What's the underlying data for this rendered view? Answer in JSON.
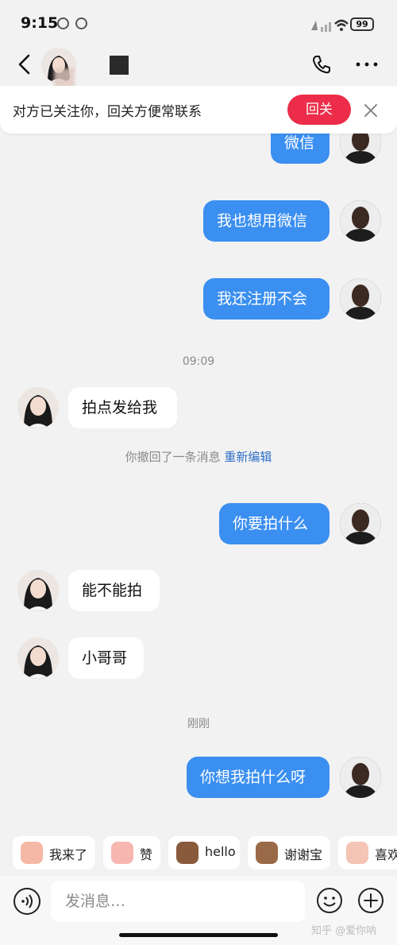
{
  "status": {
    "time": "9:15",
    "battery": "99"
  },
  "nav": {
    "name_redacted": ""
  },
  "banner": {
    "text": "对方已关注你，回关方便常联系",
    "follow_label": "回关"
  },
  "messages": [
    {
      "side": "out",
      "text": "微信"
    },
    {
      "side": "out",
      "text": "我也想用微信"
    },
    {
      "side": "out",
      "text": "我还注册不会"
    },
    {
      "side": "in",
      "text": "拍点发给我"
    },
    {
      "side": "out",
      "text": "你要拍什么"
    },
    {
      "side": "in",
      "text": "能不能拍"
    },
    {
      "side": "in",
      "text": "小哥哥"
    },
    {
      "side": "out",
      "text": "你想我拍什么呀"
    }
  ],
  "timestamps": {
    "t1": "09:09",
    "t2": "刚刚"
  },
  "recall": {
    "text": "你撤回了一条消息",
    "edit": "重新编辑"
  },
  "quick_replies": [
    "我来了",
    "赞",
    "hello",
    "谢谢宝",
    "喜欢"
  ],
  "input": {
    "placeholder": "发消息…"
  },
  "watermark": "知乎 @爱你呐",
  "colors": {
    "accent_blue": "#3b8ff0",
    "follow_red": "#ec2c48",
    "background": "#f2f2f2"
  }
}
